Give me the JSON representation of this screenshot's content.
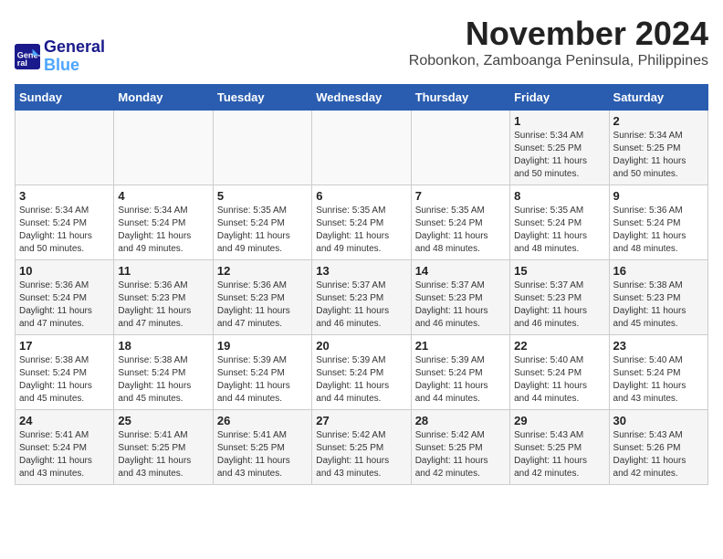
{
  "header": {
    "logo_line1": "General",
    "logo_line2": "Blue",
    "month_year": "November 2024",
    "location": "Robonkon, Zamboanga Peninsula, Philippines"
  },
  "days_of_week": [
    "Sunday",
    "Monday",
    "Tuesday",
    "Wednesday",
    "Thursday",
    "Friday",
    "Saturday"
  ],
  "weeks": [
    [
      {
        "day": "",
        "info": ""
      },
      {
        "day": "",
        "info": ""
      },
      {
        "day": "",
        "info": ""
      },
      {
        "day": "",
        "info": ""
      },
      {
        "day": "",
        "info": ""
      },
      {
        "day": "1",
        "info": "Sunrise: 5:34 AM\nSunset: 5:25 PM\nDaylight: 11 hours\nand 50 minutes."
      },
      {
        "day": "2",
        "info": "Sunrise: 5:34 AM\nSunset: 5:25 PM\nDaylight: 11 hours\nand 50 minutes."
      }
    ],
    [
      {
        "day": "3",
        "info": "Sunrise: 5:34 AM\nSunset: 5:24 PM\nDaylight: 11 hours\nand 50 minutes."
      },
      {
        "day": "4",
        "info": "Sunrise: 5:34 AM\nSunset: 5:24 PM\nDaylight: 11 hours\nand 49 minutes."
      },
      {
        "day": "5",
        "info": "Sunrise: 5:35 AM\nSunset: 5:24 PM\nDaylight: 11 hours\nand 49 minutes."
      },
      {
        "day": "6",
        "info": "Sunrise: 5:35 AM\nSunset: 5:24 PM\nDaylight: 11 hours\nand 49 minutes."
      },
      {
        "day": "7",
        "info": "Sunrise: 5:35 AM\nSunset: 5:24 PM\nDaylight: 11 hours\nand 48 minutes."
      },
      {
        "day": "8",
        "info": "Sunrise: 5:35 AM\nSunset: 5:24 PM\nDaylight: 11 hours\nand 48 minutes."
      },
      {
        "day": "9",
        "info": "Sunrise: 5:36 AM\nSunset: 5:24 PM\nDaylight: 11 hours\nand 48 minutes."
      }
    ],
    [
      {
        "day": "10",
        "info": "Sunrise: 5:36 AM\nSunset: 5:24 PM\nDaylight: 11 hours\nand 47 minutes."
      },
      {
        "day": "11",
        "info": "Sunrise: 5:36 AM\nSunset: 5:23 PM\nDaylight: 11 hours\nand 47 minutes."
      },
      {
        "day": "12",
        "info": "Sunrise: 5:36 AM\nSunset: 5:23 PM\nDaylight: 11 hours\nand 47 minutes."
      },
      {
        "day": "13",
        "info": "Sunrise: 5:37 AM\nSunset: 5:23 PM\nDaylight: 11 hours\nand 46 minutes."
      },
      {
        "day": "14",
        "info": "Sunrise: 5:37 AM\nSunset: 5:23 PM\nDaylight: 11 hours\nand 46 minutes."
      },
      {
        "day": "15",
        "info": "Sunrise: 5:37 AM\nSunset: 5:23 PM\nDaylight: 11 hours\nand 46 minutes."
      },
      {
        "day": "16",
        "info": "Sunrise: 5:38 AM\nSunset: 5:23 PM\nDaylight: 11 hours\nand 45 minutes."
      }
    ],
    [
      {
        "day": "17",
        "info": "Sunrise: 5:38 AM\nSunset: 5:24 PM\nDaylight: 11 hours\nand 45 minutes."
      },
      {
        "day": "18",
        "info": "Sunrise: 5:38 AM\nSunset: 5:24 PM\nDaylight: 11 hours\nand 45 minutes."
      },
      {
        "day": "19",
        "info": "Sunrise: 5:39 AM\nSunset: 5:24 PM\nDaylight: 11 hours\nand 44 minutes."
      },
      {
        "day": "20",
        "info": "Sunrise: 5:39 AM\nSunset: 5:24 PM\nDaylight: 11 hours\nand 44 minutes."
      },
      {
        "day": "21",
        "info": "Sunrise: 5:39 AM\nSunset: 5:24 PM\nDaylight: 11 hours\nand 44 minutes."
      },
      {
        "day": "22",
        "info": "Sunrise: 5:40 AM\nSunset: 5:24 PM\nDaylight: 11 hours\nand 44 minutes."
      },
      {
        "day": "23",
        "info": "Sunrise: 5:40 AM\nSunset: 5:24 PM\nDaylight: 11 hours\nand 43 minutes."
      }
    ],
    [
      {
        "day": "24",
        "info": "Sunrise: 5:41 AM\nSunset: 5:24 PM\nDaylight: 11 hours\nand 43 minutes."
      },
      {
        "day": "25",
        "info": "Sunrise: 5:41 AM\nSunset: 5:25 PM\nDaylight: 11 hours\nand 43 minutes."
      },
      {
        "day": "26",
        "info": "Sunrise: 5:41 AM\nSunset: 5:25 PM\nDaylight: 11 hours\nand 43 minutes."
      },
      {
        "day": "27",
        "info": "Sunrise: 5:42 AM\nSunset: 5:25 PM\nDaylight: 11 hours\nand 43 minutes."
      },
      {
        "day": "28",
        "info": "Sunrise: 5:42 AM\nSunset: 5:25 PM\nDaylight: 11 hours\nand 42 minutes."
      },
      {
        "day": "29",
        "info": "Sunrise: 5:43 AM\nSunset: 5:25 PM\nDaylight: 11 hours\nand 42 minutes."
      },
      {
        "day": "30",
        "info": "Sunrise: 5:43 AM\nSunset: 5:26 PM\nDaylight: 11 hours\nand 42 minutes."
      }
    ]
  ]
}
